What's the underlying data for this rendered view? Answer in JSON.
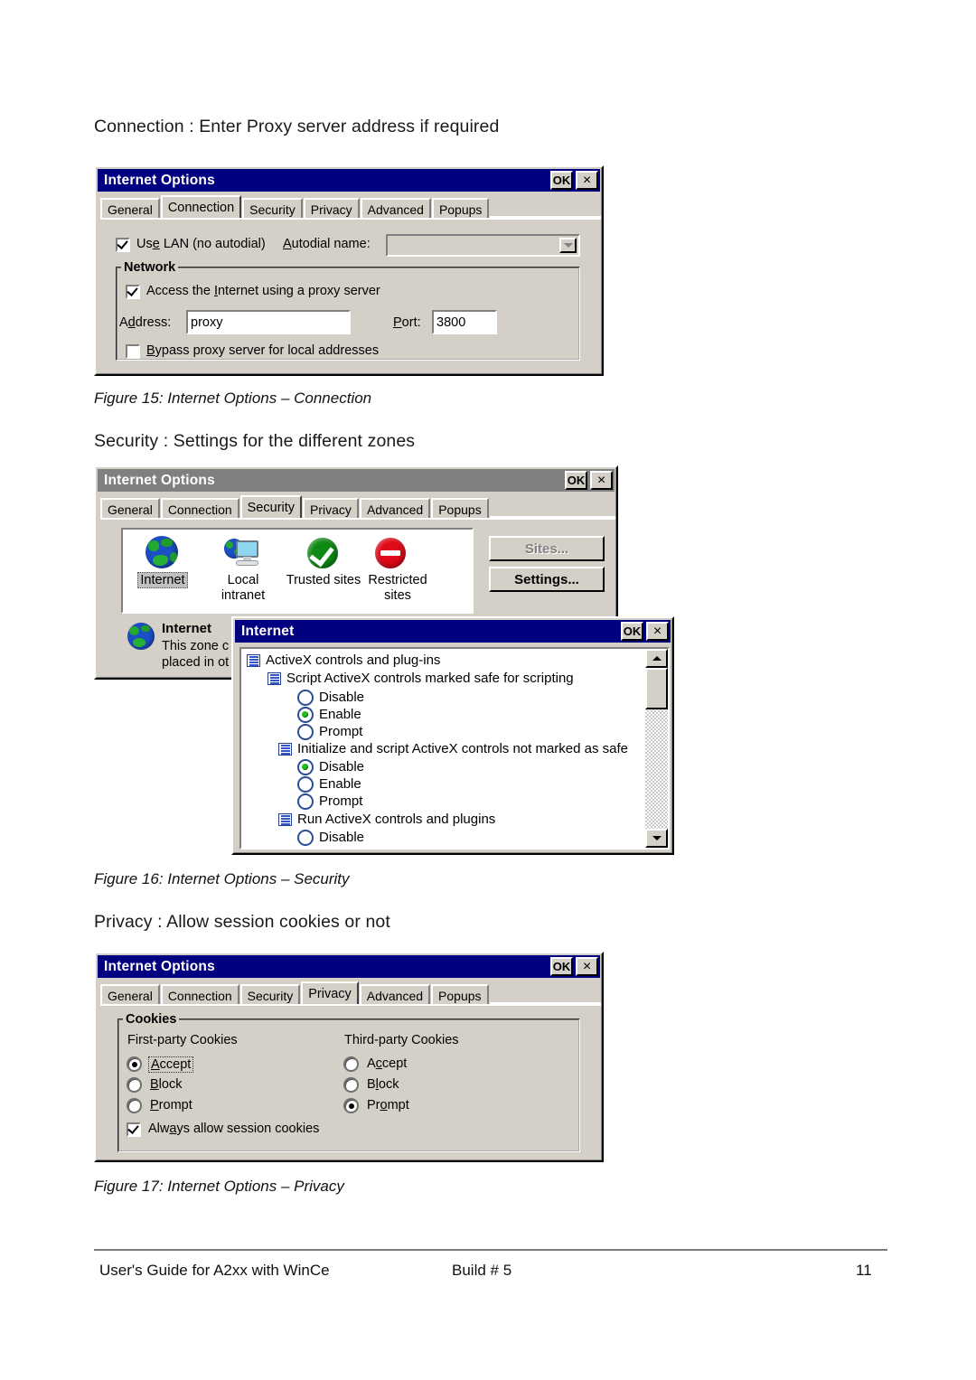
{
  "page": {
    "heading_connection": "Connection : Enter Proxy server address if required",
    "heading_security": "Security : Settings for the different zones",
    "heading_privacy": "Privacy :  Allow session cookies or not",
    "caption_15": "Figure 15: Internet Options – Connection",
    "caption_16": "Figure 16: Internet Options – Security",
    "caption_17": "Figure 17: Internet Options – Privacy"
  },
  "footer": {
    "left": "User's Guide for A2xx with WinCe",
    "center": "Build # 5",
    "right": "11"
  },
  "common": {
    "dialog_title": "Internet Options",
    "ok_label": "OK",
    "close_label": "×",
    "tabs": [
      "General",
      "Connection",
      "Security",
      "Privacy",
      "Advanced",
      "Popups"
    ],
    "titlebar_active_color": "#000080",
    "titlebar_inactive_color": "#808080",
    "dialog_face_color": "#d4d0c8"
  },
  "connection_dialog": {
    "title": "Internet Options",
    "active_tab": "Connection",
    "use_lan": {
      "label_pre": "Us",
      "label_accel": "e",
      "label_post": " LAN (no autodial)",
      "checked": true
    },
    "autodial": {
      "label_accel": "A",
      "label_post": "utodial name:",
      "value": "",
      "placeholder": ""
    },
    "network_group": "Network",
    "proxy_checkbox": {
      "pre": "Access the ",
      "accel": "I",
      "mid": "nternet usin",
      "accel2": "g",
      "post": " a proxy server",
      "checked": true
    },
    "address": {
      "label_pre": "A",
      "label_accel": "d",
      "label_post": "dress:",
      "value": "proxy"
    },
    "port": {
      "label_accel": "P",
      "label_post": "ort:",
      "value": "3800"
    },
    "bypass": {
      "label_accel": "B",
      "label_post": "ypass proxy server for local addresses",
      "checked": false
    }
  },
  "security_dialog": {
    "title": "Internet Options",
    "active_tab": "Security",
    "zones": [
      {
        "name": "Internet",
        "caption": "Internet",
        "icon": "globe-icon",
        "selected": true
      },
      {
        "name": "Local intranet",
        "caption_line1": "Local",
        "caption_line2": "intranet",
        "icon": "intranet-icon",
        "selected": false
      },
      {
        "name": "Trusted sites",
        "caption": "Trusted sites",
        "icon": "trusted-check-icon",
        "selected": false
      },
      {
        "name": "Restricted sites",
        "caption_line1": "Restricted",
        "caption_line2": "sites",
        "icon": "restricted-deny-icon",
        "selected": false
      }
    ],
    "sites_button": {
      "label": "Sites...",
      "disabled": true
    },
    "settings_button": {
      "label": "Settings...",
      "disabled": false
    },
    "zone_info": {
      "title": "Internet",
      "line1": "This zone c",
      "line2": "placed in ot"
    }
  },
  "internet_popup": {
    "title": "Internet",
    "ok_label": "OK",
    "close_label": "×",
    "tree": [
      {
        "type": "category",
        "level": 0,
        "label": "ActiveX controls and plug-ins"
      },
      {
        "type": "category",
        "level": 1,
        "label": "Script ActiveX controls marked safe for scripting"
      },
      {
        "type": "radio",
        "level": 2,
        "label": "Disable",
        "selected": false
      },
      {
        "type": "radio",
        "level": 2,
        "label": "Enable",
        "selected": true
      },
      {
        "type": "radio",
        "level": 2,
        "label": "Prompt",
        "selected": false
      },
      {
        "type": "category",
        "level": 1,
        "label": "Initialize and script ActiveX controls not marked as safe"
      },
      {
        "type": "radio",
        "level": 2,
        "label": "Disable",
        "selected": true
      },
      {
        "type": "radio",
        "level": 2,
        "label": "Enable",
        "selected": false
      },
      {
        "type": "radio",
        "level": 2,
        "label": "Prompt",
        "selected": false
      },
      {
        "type": "category",
        "level": 1,
        "label": "Run ActiveX controls and plugins"
      },
      {
        "type": "radio",
        "level": 2,
        "label": "Disable",
        "selected": false
      }
    ],
    "scrollbar": {
      "position": "top"
    }
  },
  "privacy_dialog": {
    "title": "Internet Options",
    "active_tab": "Privacy",
    "cookies_group": "Cookies",
    "first_party_label": "First-party Cookies",
    "third_party_label": "Third-party Cookies",
    "first_party": [
      {
        "label_accel": "A",
        "label_post": "ccept",
        "selected": true,
        "focused": true
      },
      {
        "label_accel": "B",
        "label_post": "lock",
        "selected": false,
        "focused": false
      },
      {
        "label_accel": "P",
        "label_post": "rompt",
        "selected": false,
        "focused": false
      }
    ],
    "third_party": [
      {
        "label_pre": "A",
        "label_accel": "c",
        "label_post": "cept",
        "selected": false
      },
      {
        "label_pre": "B",
        "label_accel": "l",
        "label_post": "ock",
        "selected": false
      },
      {
        "label_pre": "Pr",
        "label_accel": "o",
        "label_post": "mpt",
        "selected": true
      }
    ],
    "session_cookies": {
      "pre": "Alw",
      "accel": "a",
      "post": "ys allow session cookies",
      "checked": true
    }
  }
}
